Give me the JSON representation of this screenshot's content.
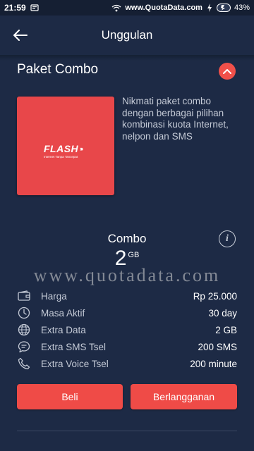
{
  "status_bar": {
    "time": "21:59",
    "site": "www.QuotaData.com",
    "battery": "43%"
  },
  "app_bar": {
    "title": "Unggulan"
  },
  "package": {
    "title": "Paket Combo",
    "logo_text": "FLASH",
    "logo_tagline": "Internet Tanpa Tancepat",
    "description": "Nikmati paket combo dengan berbagai pilihan kombinasi kuota Internet, nelpon dan SMS",
    "name": "Combo",
    "amount": "2",
    "unit": "GB"
  },
  "watermark": "www.quotadata.com",
  "details": [
    {
      "icon": "wallet-icon",
      "label": "Harga",
      "value": "Rp 25.000"
    },
    {
      "icon": "clock-icon",
      "label": "Masa Aktif",
      "value": "30 day"
    },
    {
      "icon": "globe-icon",
      "label": "Extra Data",
      "value": "2 GB"
    },
    {
      "icon": "chat-bubble-icon",
      "label": "Extra SMS Tsel",
      "value": "200 SMS"
    },
    {
      "icon": "phone-icon",
      "label": "Extra Voice Tsel",
      "value": "200 minute"
    }
  ],
  "actions": {
    "buy_label": "Beli",
    "subscribe_label": "Berlangganan"
  },
  "colors": {
    "background": "#1d2a45",
    "accent": "#ef4b47",
    "card": "#e8474a"
  }
}
